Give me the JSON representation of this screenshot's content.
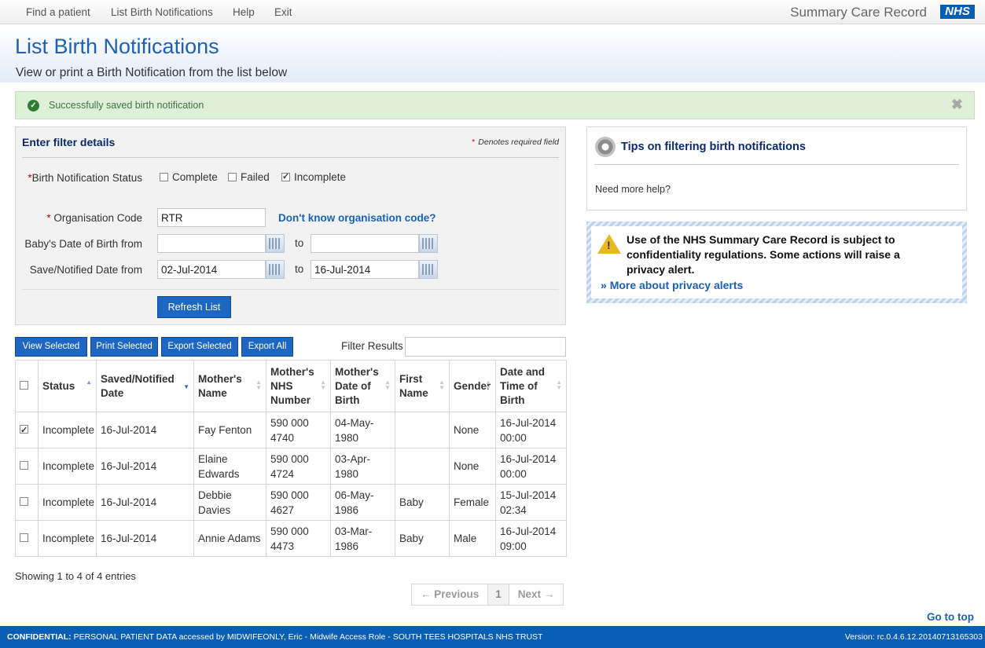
{
  "nav": {
    "items": [
      "Find a patient",
      "List Birth Notifications",
      "Help",
      "Exit"
    ],
    "brand": "Summary Care Record",
    "logo": "NHS"
  },
  "header": {
    "title": "List Birth Notifications",
    "subtitle": "View or print a Birth Notification from the list below"
  },
  "alert": {
    "message": "Successfully saved birth notification",
    "close": "✖"
  },
  "filter": {
    "title": "Enter filter details",
    "required_note": "Denotes required field",
    "status_label": "Birth Notification Status",
    "status_options": [
      {
        "label": "Complete",
        "checked": false
      },
      {
        "label": "Failed",
        "checked": false
      },
      {
        "label": "Incomplete",
        "checked": true
      }
    ],
    "org_label": "Organisation Code",
    "org_value": "RTR",
    "org_link": "Don't know organisation code?",
    "dob_label": "Baby's Date of Birth from",
    "dob_from": "",
    "dob_to": "",
    "to_label": "to",
    "saved_label": "Save/Notified Date from",
    "saved_from": "02-Jul-2014",
    "saved_to": "16-Jul-2014",
    "refresh": "Refresh List"
  },
  "tips": {
    "title": "Tips on filtering birth notifications",
    "help": "Need more help?"
  },
  "privacy": {
    "text": "Use of the NHS Summary Care Record is subject to confidentiality regulations. Some actions will raise a privacy alert.",
    "link": "More about privacy alerts"
  },
  "actions": {
    "view": "View Selected",
    "print": "Print Selected",
    "export": "Export Selected",
    "export_all": "Export All",
    "filter_label": "Filter Results",
    "filter_value": ""
  },
  "table": {
    "headers": [
      "Status",
      "Saved/Notified Date",
      "Mother's Name",
      "Mother's NHS Number",
      "Mother's Date of Birth",
      "First Name",
      "Gender",
      "Date and Time of Birth"
    ],
    "rows": [
      {
        "checked": true,
        "cells": [
          "Incomplete",
          "16-Jul-2014",
          "Fay Fenton",
          "590 000 4740",
          "04-May-1980",
          "",
          "None",
          "16-Jul-2014 00:00"
        ]
      },
      {
        "checked": false,
        "cells": [
          "Incomplete",
          "16-Jul-2014",
          "Elaine Edwards",
          "590 000 4724",
          "03-Apr-1980",
          "",
          "None",
          "16-Jul-2014 00:00"
        ]
      },
      {
        "checked": false,
        "cells": [
          "Incomplete",
          "16-Jul-2014",
          "Debbie Davies",
          "590 000 4627",
          "06-May-1986",
          "Baby",
          "Female",
          "15-Jul-2014 02:34"
        ]
      },
      {
        "checked": false,
        "cells": [
          "Incomplete",
          "16-Jul-2014",
          "Annie Adams",
          "590 000 4473",
          "03-Mar-1986",
          "Baby",
          "Male",
          "16-Jul-2014 09:00"
        ]
      }
    ],
    "showing": "Showing 1 to 4 of 4 entries"
  },
  "pager": {
    "prev": "← Previous",
    "page": "1",
    "next": "Next →"
  },
  "goto_top": "Go to top",
  "footer": {
    "confidential": "CONFIDENTIAL:",
    "details": " PERSONAL PATIENT DATA accessed by MIDWIFEONLY, Eric - Midwife Access Role - SOUTH TEES HOSPITALS NHS TRUST",
    "version": "Version: rc.0.4.6.12.20140713165303"
  },
  "colors": {
    "primary_blue": "#1d67c3",
    "nhs_blue": "#0a5eb3",
    "success_bg": "#dff0d8"
  }
}
